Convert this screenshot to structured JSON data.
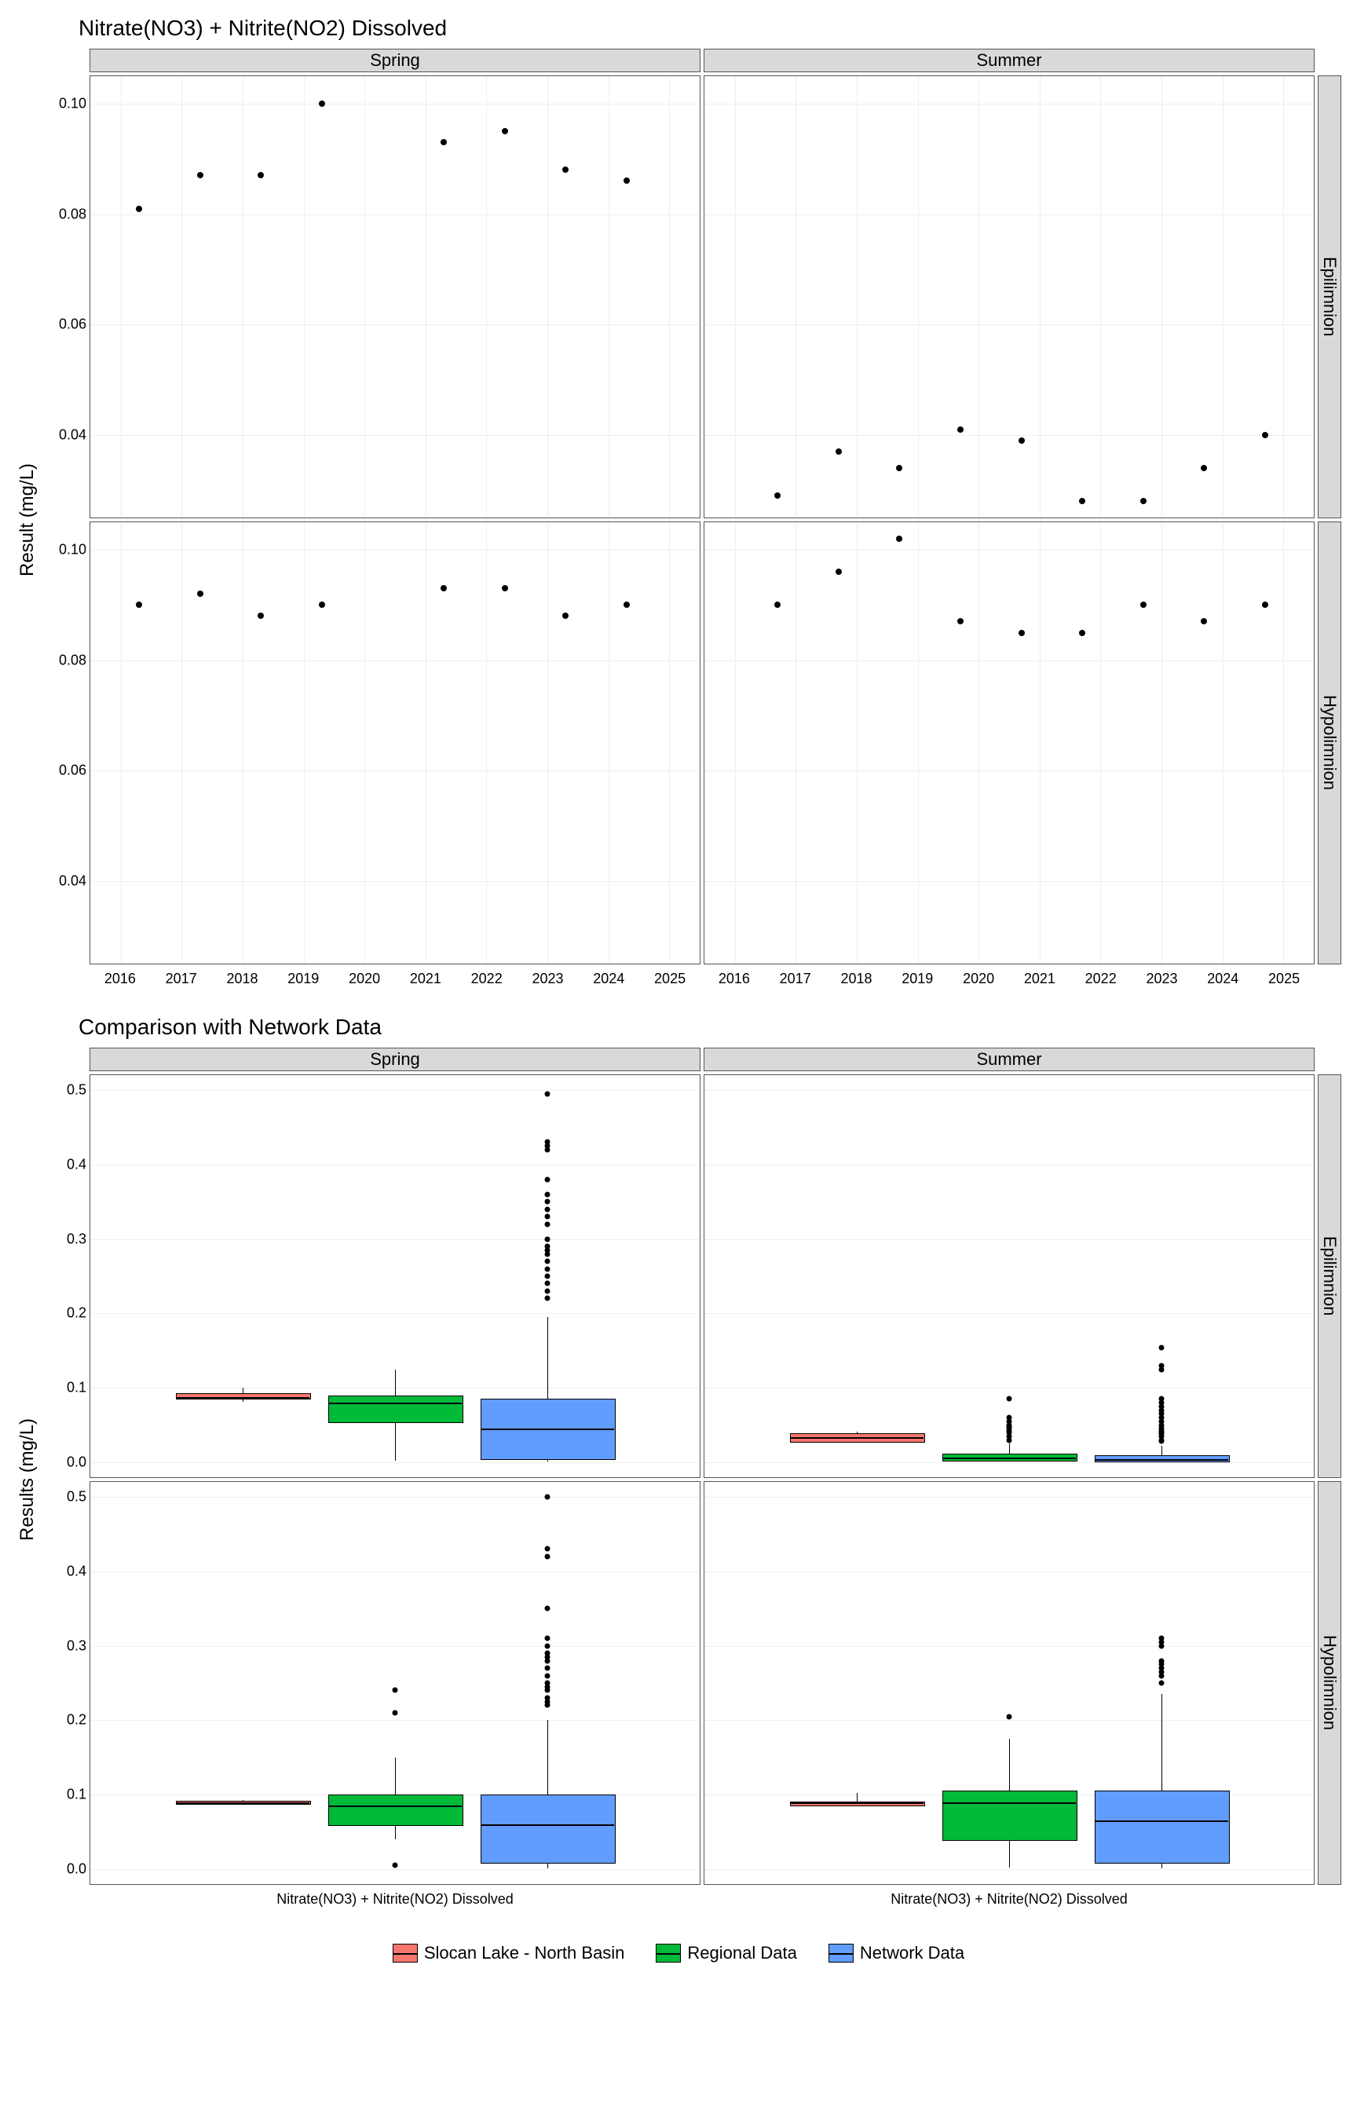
{
  "chart_data": [
    {
      "type": "scatter",
      "title": "Nitrate(NO3) + Nitrite(NO2) Dissolved",
      "ylabel": "Result (mg/L)",
      "facets_col": [
        "Spring",
        "Summer"
      ],
      "facets_row": [
        "Epilimnion",
        "Hypolimnion"
      ],
      "x_ticks": [
        2016,
        2017,
        2018,
        2019,
        2020,
        2021,
        2022,
        2023,
        2024,
        2025
      ],
      "y_ticks": [
        0.04,
        0.06,
        0.08,
        0.1
      ],
      "ylim": [
        0.025,
        0.105
      ],
      "panels": {
        "Spring_Epilimnion": [
          {
            "x": 2016.3,
            "y": 0.081
          },
          {
            "x": 2017.3,
            "y": 0.087
          },
          {
            "x": 2018.3,
            "y": 0.087
          },
          {
            "x": 2019.3,
            "y": 0.1
          },
          {
            "x": 2021.3,
            "y": 0.093
          },
          {
            "x": 2022.3,
            "y": 0.095
          },
          {
            "x": 2023.3,
            "y": 0.088
          },
          {
            "x": 2024.3,
            "y": 0.086
          }
        ],
        "Summer_Epilimnion": [
          {
            "x": 2016.7,
            "y": 0.029
          },
          {
            "x": 2017.7,
            "y": 0.037
          },
          {
            "x": 2018.7,
            "y": 0.034
          },
          {
            "x": 2019.7,
            "y": 0.041
          },
          {
            "x": 2020.7,
            "y": 0.039
          },
          {
            "x": 2021.7,
            "y": 0.028
          },
          {
            "x": 2022.7,
            "y": 0.028
          },
          {
            "x": 2023.7,
            "y": 0.034
          },
          {
            "x": 2024.7,
            "y": 0.04
          }
        ],
        "Spring_Hypolimnion": [
          {
            "x": 2016.3,
            "y": 0.09
          },
          {
            "x": 2017.3,
            "y": 0.092
          },
          {
            "x": 2018.3,
            "y": 0.088
          },
          {
            "x": 2019.3,
            "y": 0.09
          },
          {
            "x": 2021.3,
            "y": 0.093
          },
          {
            "x": 2022.3,
            "y": 0.093
          },
          {
            "x": 2023.3,
            "y": 0.088
          },
          {
            "x": 2024.3,
            "y": 0.09
          }
        ],
        "Summer_Hypolimnion": [
          {
            "x": 2016.7,
            "y": 0.09
          },
          {
            "x": 2017.7,
            "y": 0.096
          },
          {
            "x": 2018.7,
            "y": 0.102
          },
          {
            "x": 2019.7,
            "y": 0.087
          },
          {
            "x": 2020.7,
            "y": 0.085
          },
          {
            "x": 2021.7,
            "y": 0.085
          },
          {
            "x": 2022.7,
            "y": 0.09
          },
          {
            "x": 2023.7,
            "y": 0.087
          },
          {
            "x": 2024.7,
            "y": 0.09
          }
        ]
      }
    },
    {
      "type": "boxplot",
      "title": "Comparison with Network Data",
      "ylabel": "Results (mg/L)",
      "xlabel": "Nitrate(NO3) + Nitrite(NO2) Dissolved",
      "facets_col": [
        "Spring",
        "Summer"
      ],
      "facets_row": [
        "Epilimnion",
        "Hypolimnion"
      ],
      "y_ticks": [
        0.0,
        0.1,
        0.2,
        0.3,
        0.4,
        0.5
      ],
      "ylim": [
        -0.02,
        0.52
      ],
      "series_order": [
        "Slocan Lake - North Basin",
        "Regional Data",
        "Network Data"
      ],
      "colors": {
        "Slocan Lake - North Basin": "#f8766d",
        "Regional Data": "#00ba38",
        "Network Data": "#619cff"
      },
      "panels": {
        "Spring_Epilimnion": {
          "Slocan Lake - North Basin": {
            "min": 0.081,
            "q1": 0.086,
            "median": 0.088,
            "q3": 0.093,
            "max": 0.1,
            "outliers": []
          },
          "Regional Data": {
            "min": 0.002,
            "q1": 0.055,
            "median": 0.08,
            "q3": 0.09,
            "max": 0.125,
            "outliers": []
          },
          "Network Data": {
            "min": 0.001,
            "q1": 0.005,
            "median": 0.045,
            "q3": 0.085,
            "max": 0.195,
            "outliers": [
              0.22,
              0.23,
              0.24,
              0.25,
              0.26,
              0.27,
              0.28,
              0.285,
              0.29,
              0.3,
              0.32,
              0.33,
              0.34,
              0.35,
              0.36,
              0.38,
              0.42,
              0.425,
              0.43,
              0.495
            ]
          }
        },
        "Summer_Epilimnion": {
          "Slocan Lake - North Basin": {
            "min": 0.028,
            "q1": 0.029,
            "median": 0.034,
            "q3": 0.039,
            "max": 0.041,
            "outliers": []
          },
          "Regional Data": {
            "min": 0.001,
            "q1": 0.003,
            "median": 0.006,
            "q3": 0.012,
            "max": 0.025,
            "outliers": [
              0.03,
              0.035,
              0.04,
              0.042,
              0.045,
              0.048,
              0.05,
              0.055,
              0.06,
              0.085
            ]
          },
          "Network Data": {
            "min": 0.001,
            "q1": 0.002,
            "median": 0.004,
            "q3": 0.01,
            "max": 0.022,
            "outliers": [
              0.028,
              0.03,
              0.035,
              0.038,
              0.04,
              0.042,
              0.045,
              0.05,
              0.055,
              0.06,
              0.065,
              0.07,
              0.075,
              0.08,
              0.085,
              0.124,
              0.13,
              0.154
            ]
          }
        },
        "Spring_Hypolimnion": {
          "Slocan Lake - North Basin": {
            "min": 0.088,
            "q1": 0.089,
            "median": 0.09,
            "q3": 0.092,
            "max": 0.093,
            "outliers": []
          },
          "Regional Data": {
            "min": 0.04,
            "q1": 0.06,
            "median": 0.085,
            "q3": 0.1,
            "max": 0.15,
            "outliers": [
              0.005,
              0.21,
              0.24
            ]
          },
          "Network Data": {
            "min": 0.001,
            "q1": 0.01,
            "median": 0.06,
            "q3": 0.1,
            "max": 0.2,
            "outliers": [
              0.22,
              0.225,
              0.23,
              0.24,
              0.245,
              0.25,
              0.26,
              0.27,
              0.28,
              0.285,
              0.29,
              0.3,
              0.31,
              0.35,
              0.42,
              0.43,
              0.5
            ]
          }
        },
        "Summer_Hypolimnion": {
          "Slocan Lake - North Basin": {
            "min": 0.085,
            "q1": 0.087,
            "median": 0.09,
            "q3": 0.091,
            "max": 0.102,
            "outliers": []
          },
          "Regional Data": {
            "min": 0.002,
            "q1": 0.04,
            "median": 0.09,
            "q3": 0.105,
            "max": 0.175,
            "outliers": [
              0.205
            ]
          },
          "Network Data": {
            "min": 0.001,
            "q1": 0.01,
            "median": 0.065,
            "q3": 0.105,
            "max": 0.235,
            "outliers": [
              0.25,
              0.26,
              0.265,
              0.27,
              0.275,
              0.28,
              0.3,
              0.305,
              0.31
            ]
          }
        }
      }
    }
  ],
  "legend": {
    "items": [
      "Slocan Lake - North Basin",
      "Regional Data",
      "Network Data"
    ]
  }
}
